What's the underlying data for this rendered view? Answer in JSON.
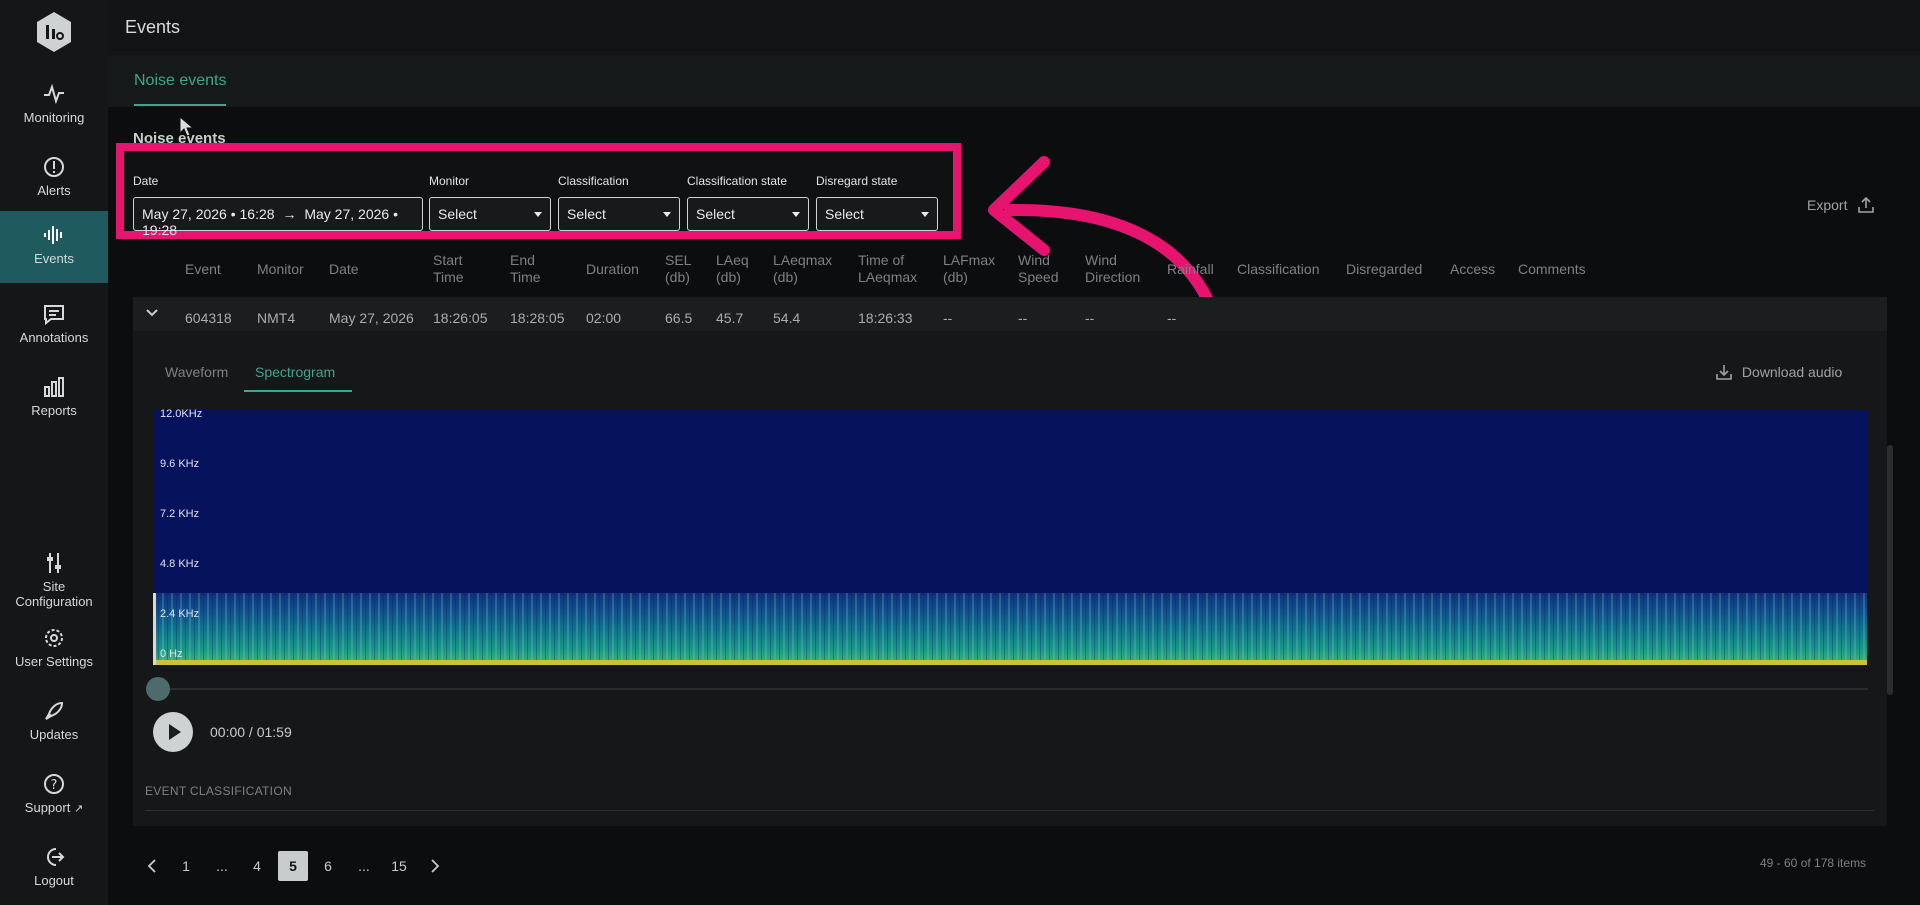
{
  "sidebar": {
    "items": [
      {
        "label": "Monitoring",
        "icon": "pulse-icon"
      },
      {
        "label": "Alerts",
        "icon": "alert-icon"
      },
      {
        "label": "Events",
        "icon": "waveform-icon"
      },
      {
        "label": "Annotations",
        "icon": "annotation-icon"
      },
      {
        "label": "Reports",
        "icon": "reports-icon"
      },
      {
        "label_line1": "Site",
        "label_line2": "Configuration",
        "icon": "sliders-icon"
      },
      {
        "label": "User Settings",
        "icon": "gear-icon"
      },
      {
        "label": "Updates",
        "icon": "rocket-icon"
      },
      {
        "label": "Support",
        "icon": "help-icon"
      },
      {
        "label": "Logout",
        "icon": "logout-icon"
      }
    ]
  },
  "header": {
    "title": "Events"
  },
  "tabs": {
    "active": "Noise events"
  },
  "section": {
    "title": "Noise events"
  },
  "filters": {
    "date_label": "Date",
    "date_from": "May 27, 2026 • 16:28",
    "date_arrow": "→",
    "date_to": "May 27, 2026 • 19:28",
    "monitor_label": "Monitor",
    "monitor_value": "Select",
    "classification_label": "Classification",
    "classification_value": "Select",
    "class_state_label": "Classification state",
    "class_state_value": "Select",
    "disregard_label": "Disregard state",
    "disregard_value": "Select"
  },
  "export": {
    "label": "Export"
  },
  "table": {
    "headers": [
      {
        "l1": "Event",
        "l2": ""
      },
      {
        "l1": "Monitor",
        "l2": ""
      },
      {
        "l1": "Date",
        "l2": ""
      },
      {
        "l1": "Start",
        "l2": "Time"
      },
      {
        "l1": "End",
        "l2": "Time"
      },
      {
        "l1": "Duration",
        "l2": ""
      },
      {
        "l1": "SEL",
        "l2": "(db)"
      },
      {
        "l1": "LAeq",
        "l2": "(db)"
      },
      {
        "l1": "LAeqmax",
        "l2": "(db)"
      },
      {
        "l1": "Time of",
        "l2": "LAeqmax"
      },
      {
        "l1": "LAFmax",
        "l2": "(db)"
      },
      {
        "l1": "Wind",
        "l2": "Speed"
      },
      {
        "l1": "Wind",
        "l2": "Direction"
      },
      {
        "l1": "Rainfall",
        "l2": ""
      },
      {
        "l1": "Classification",
        "l2": ""
      },
      {
        "l1": "Disregarded",
        "l2": ""
      },
      {
        "l1": "Access",
        "l2": ""
      },
      {
        "l1": "Comments",
        "l2": ""
      }
    ],
    "row": [
      "604318",
      "NMT4",
      "May 27, 2026",
      "18:26:05",
      "18:28:05",
      "02:00",
      "66.5",
      "45.7",
      "54.4",
      "18:26:33",
      "--",
      "--",
      "--",
      "--"
    ]
  },
  "detail": {
    "tab_waveform": "Waveform",
    "tab_spectrogram": "Spectrogram",
    "download": "Download audio",
    "y_labels": [
      "12.0KHz",
      "9.6 KHz",
      "7.2 KHz",
      "4.8 KHz",
      "2.4 KHz",
      "0   Hz"
    ],
    "time": "00:00 / 01:59",
    "event_classification": "EVENT CLASSIFICATION"
  },
  "pagination": {
    "pages": [
      "1",
      "...",
      "4",
      "5",
      "6",
      "...",
      "15"
    ],
    "active": "5",
    "count": "49 - 60 of 178 items"
  },
  "colors": {
    "accent": "#3ea58f",
    "highlight": "#e6136f",
    "active_nav": "#1f5a5f"
  }
}
